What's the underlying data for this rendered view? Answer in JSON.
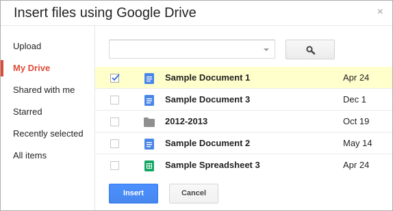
{
  "dialog": {
    "title": "Insert files using Google Drive",
    "close_glyph": "×"
  },
  "sidebar": {
    "items": [
      {
        "label": "Upload",
        "active": false
      },
      {
        "label": "My Drive",
        "active": true
      },
      {
        "label": "Shared with me",
        "active": false
      },
      {
        "label": "Starred",
        "active": false
      },
      {
        "label": "Recently selected",
        "active": false
      },
      {
        "label": "All items",
        "active": false
      }
    ]
  },
  "search": {
    "value": "",
    "placeholder": "",
    "button_icon": "search-icon"
  },
  "files": [
    {
      "name": "Sample Document 1",
      "date": "Apr 24",
      "type": "document",
      "icon": "document-icon",
      "checked": true
    },
    {
      "name": "Sample Document 3",
      "date": "Dec 1",
      "type": "document",
      "icon": "document-icon",
      "checked": false
    },
    {
      "name": "2012-2013",
      "date": "Oct 19",
      "type": "folder",
      "icon": "folder-icon",
      "checked": false
    },
    {
      "name": "Sample Document 2",
      "date": "May 14",
      "type": "document",
      "icon": "document-icon",
      "checked": false
    },
    {
      "name": "Sample Spreadsheet 3",
      "date": "Apr 24",
      "type": "spreadsheet",
      "icon": "spreadsheet-icon",
      "checked": false
    }
  ],
  "buttons": {
    "insert_label": "Insert",
    "cancel_label": "Cancel"
  },
  "colors": {
    "accent_red": "#dd4b39",
    "primary_blue": "#4d90fe",
    "selected_row": "#ffffcc",
    "doc_blue": "#4a86e8",
    "sheet_green": "#16a765",
    "folder_gray": "#8f8f8f"
  }
}
